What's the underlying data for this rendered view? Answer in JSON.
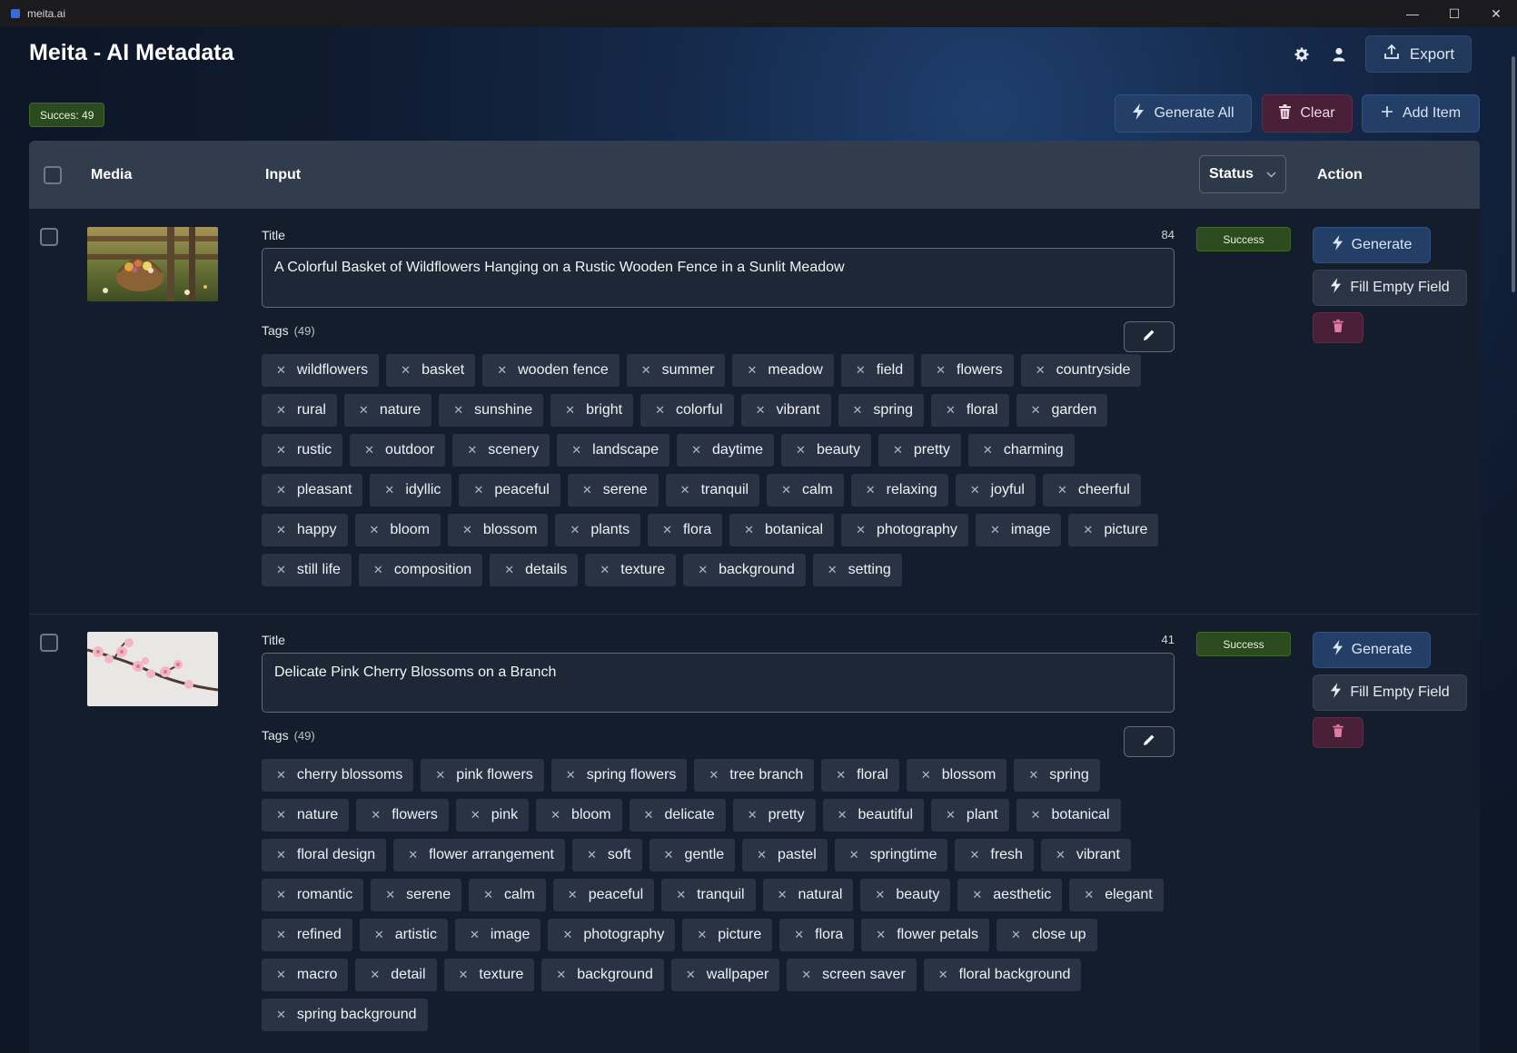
{
  "window": {
    "title": "meita.ai",
    "controls": [
      "—",
      "☐",
      "✕"
    ]
  },
  "header": {
    "app_title": "Meita - AI Metadata",
    "export_label": "Export",
    "settings_icon": "gear-icon",
    "user_icon": "user-icon",
    "export_icon": "upload-icon"
  },
  "toolbar": {
    "success_count": "Succes: 49",
    "generate_all_label": "Generate All",
    "clear_label": "Clear",
    "add_item_label": "Add Item"
  },
  "table": {
    "columns": {
      "media": "Media",
      "input": "Input",
      "status": "Status",
      "action": "Action"
    }
  },
  "rows": [
    {
      "title_label": "Title",
      "char_count": "84",
      "title": "A Colorful Basket of Wildflowers Hanging on a Rustic Wooden Fence in a Sunlit Meadow",
      "tags_label": "Tags",
      "tags_count": "(49)",
      "status": "Success",
      "generate_label": "Generate",
      "fill_label": "Fill Empty Field",
      "tags": [
        "wildflowers",
        "basket",
        "wooden fence",
        "summer",
        "meadow",
        "field",
        "flowers",
        "countryside",
        "rural",
        "nature",
        "sunshine",
        "bright",
        "colorful",
        "vibrant",
        "spring",
        "floral",
        "garden",
        "rustic",
        "outdoor",
        "scenery",
        "landscape",
        "daytime",
        "beauty",
        "pretty",
        "charming",
        "pleasant",
        "idyllic",
        "peaceful",
        "serene",
        "tranquil",
        "calm",
        "relaxing",
        "joyful",
        "cheerful",
        "happy",
        "bloom",
        "blossom",
        "plants",
        "flora",
        "botanical",
        "photography",
        "image",
        "picture",
        "still life",
        "composition",
        "details",
        "texture",
        "background",
        "setting"
      ]
    },
    {
      "title_label": "Title",
      "char_count": "41",
      "title": "Delicate Pink Cherry Blossoms on a Branch",
      "tags_label": "Tags",
      "tags_count": "(49)",
      "status": "Success",
      "generate_label": "Generate",
      "fill_label": "Fill Empty Field",
      "tags": [
        "cherry blossoms",
        "pink flowers",
        "spring flowers",
        "tree branch",
        "floral",
        "blossom",
        "spring",
        "nature",
        "flowers",
        "pink",
        "bloom",
        "delicate",
        "pretty",
        "beautiful",
        "plant",
        "botanical",
        "floral design",
        "flower arrangement",
        "soft",
        "gentle",
        "pastel",
        "springtime",
        "fresh",
        "vibrant",
        "romantic",
        "serene",
        "calm",
        "peaceful",
        "tranquil",
        "natural",
        "beauty",
        "aesthetic",
        "elegant",
        "refined",
        "artistic",
        "image",
        "photography",
        "picture",
        "flora",
        "flower petals",
        "close up",
        "macro",
        "detail",
        "texture",
        "background",
        "wallpaper",
        "screen saver",
        "floral background",
        "spring background"
      ]
    }
  ]
}
